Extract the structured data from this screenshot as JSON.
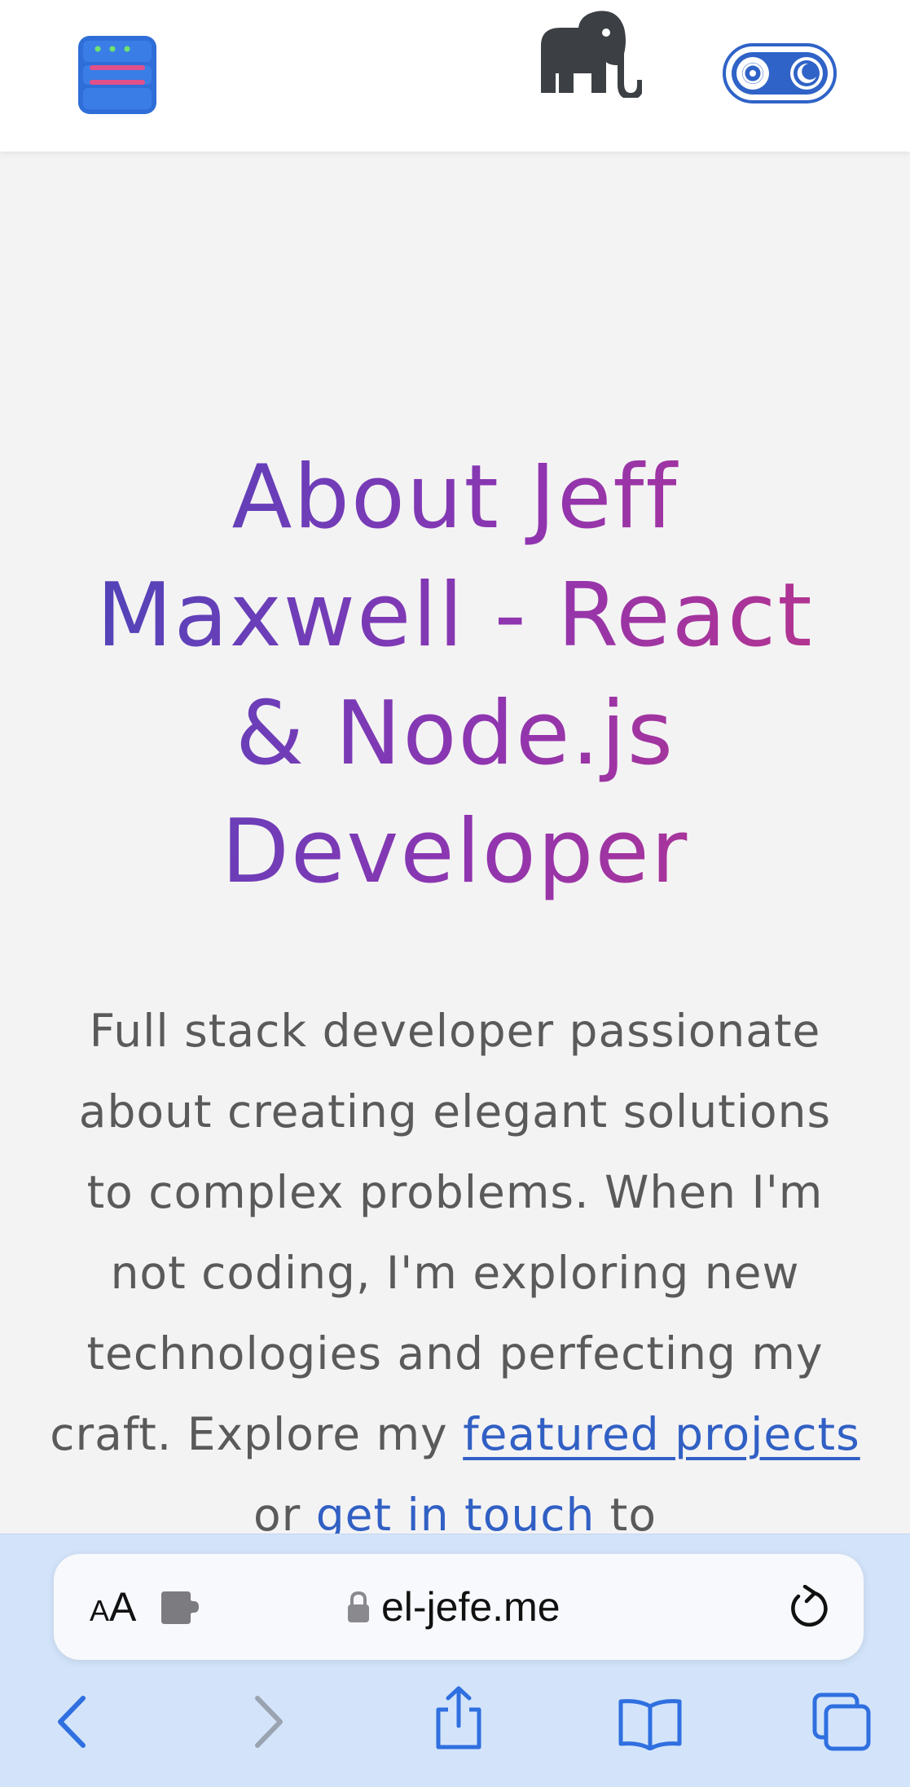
{
  "header": {
    "logo_icon": "server-stack-icon",
    "mascot_icon": "elephant-icon",
    "theme_toggle": {
      "icons": [
        "sun-gear-icon",
        "moon-icon"
      ],
      "accent": "#2f63c7"
    }
  },
  "hero": {
    "title": "About Jeff Maxwell - React & Node.js Developer",
    "description_parts": {
      "intro": "Full stack developer passionate about creating elegant solutions to complex problems. When I'm not coding, I'm exploring new technologies and perfecting my craft. Explore my ",
      "link_projects": "featured projects",
      "middle": " or ",
      "link_contact": "get in touch",
      "outro": " to"
    },
    "gradient_colors": [
      "#4746b8",
      "#8f35b0",
      "#bd3488"
    ],
    "link_color": "#3160c4",
    "text_color": "#5a5a5a"
  },
  "browser": {
    "text_size_small": "A",
    "text_size_big": "A",
    "url": "el-jefe.me",
    "icons": {
      "extension": "puzzle-piece-icon",
      "lock": "lock-icon",
      "reload": "reload-icon",
      "back": "chevron-left-icon",
      "forward": "chevron-right-icon",
      "share": "share-icon",
      "bookmarks": "book-icon",
      "tabs": "tabs-icon"
    },
    "chrome_color": "#d3e4fa",
    "accent": "#2f6fe0"
  }
}
